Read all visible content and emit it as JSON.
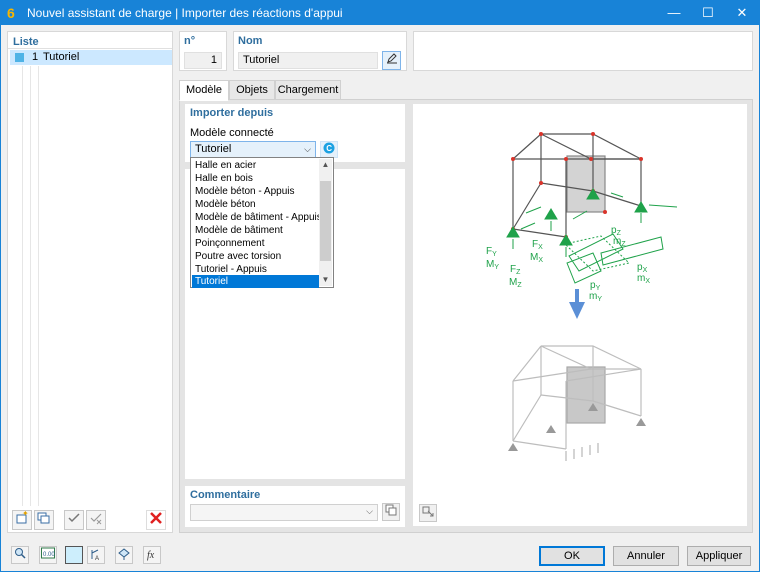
{
  "window": {
    "title": "Nouvel assistant de charge | Importer des réactions d'appui",
    "minimize": "—",
    "maximize": "☐",
    "close": "✕"
  },
  "list": {
    "title": "Liste",
    "items": [
      {
        "number": "1",
        "label": "Tutoriel"
      }
    ]
  },
  "header": {
    "number_label": "n°",
    "number_value": "1",
    "name_label": "Nom",
    "name_value": "Tutoriel"
  },
  "tabs": [
    {
      "label": "Modèle",
      "active": true
    },
    {
      "label": "Objets",
      "active": false
    },
    {
      "label": "Chargement",
      "active": false
    }
  ],
  "import": {
    "title": "Importer depuis",
    "field_label": "Modèle connecté",
    "selected": "Tutoriel",
    "options": [
      "Halle en acier",
      "Halle en bois",
      "Modèle béton - Appuis",
      "Modèle béton",
      "Modèle de bâtiment - Appuis",
      "Modèle de bâtiment",
      "Poinçonnement",
      "Poutre avec torsion",
      "Tutoriel - Appuis",
      "Tutoriel"
    ]
  },
  "comment": {
    "title": "Commentaire",
    "value": ""
  },
  "diagram": {
    "labels": {
      "fy": "F",
      "fy_sub": "Y",
      "my": "M",
      "my_sub": "Y",
      "fx": "F",
      "fx_sub": "X",
      "mx": "M",
      "mx_sub": "X",
      "fz": "F",
      "fz_sub": "Z",
      "mz": "M",
      "mz_sub": "Z",
      "pz": "p",
      "pz_sub": "Z",
      "mz2": "m",
      "mz2_sub": "Z",
      "px": "p",
      "px_sub": "X",
      "mx2": "m",
      "mx2_sub": "X",
      "py": "p",
      "py_sub": "Y",
      "my2": "m",
      "my2_sub": "Y"
    },
    "colors": {
      "accent": "#1fa24a",
      "node": "#d9342b",
      "arrow": "#5b8fd6"
    }
  },
  "buttons": {
    "ok": "OK",
    "cancel": "Annuler",
    "apply": "Appliquer"
  },
  "colors": {
    "titlebar": "#1883d7",
    "section_title": "#2f6e9e",
    "selection": "#0078d7"
  }
}
